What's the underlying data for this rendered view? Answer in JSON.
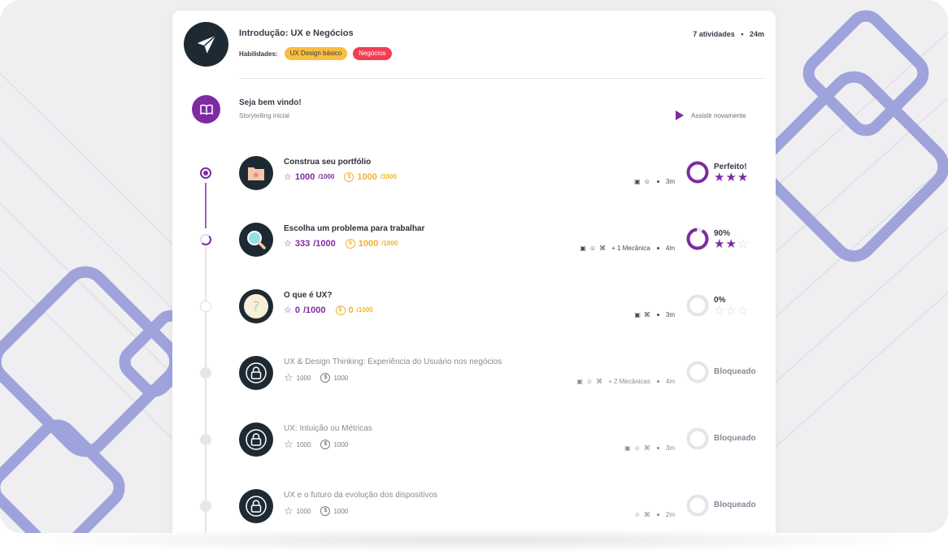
{
  "course": {
    "title": "Introdução: UX e Negócios",
    "activities_count": "7 atividades",
    "duration": "24m",
    "skills_label": "Habilidades:",
    "skills": [
      "UX Design básico",
      "Negócios"
    ]
  },
  "welcome": {
    "title": "Seja bem vindo!",
    "subtitle": "Storytelling inicial",
    "rewatch_label": "Assistir novamente"
  },
  "activities": [
    {
      "title": "Construa seu portfólio",
      "xp": "1000",
      "xp_total": "/1000",
      "coins": "1000",
      "coins_total": "/1000",
      "media_icons": [
        "video-icon",
        "smiley-icon"
      ],
      "mechanics": "",
      "duration": "3m",
      "status": "Perfeito!",
      "progress": 1.0,
      "stars": 3,
      "icon": "folder-star-icon"
    },
    {
      "title": "Escolha um problema para trabalhar",
      "xp": "333",
      "xp_total": "/1000",
      "coins": "1000",
      "coins_total": "/1000",
      "media_icons": [
        "video-icon",
        "smiley-icon",
        "command-icon"
      ],
      "mechanics": "+ 1 Mecânica",
      "duration": "4m",
      "status": "90%",
      "progress": 0.9,
      "stars": 2,
      "icon": "magnifier-icon"
    },
    {
      "title": "O que é UX?",
      "xp": "0",
      "xp_total": "/1000",
      "coins": "0",
      "coins_total": "/1000",
      "media_icons": [
        "video-icon",
        "command-icon"
      ],
      "mechanics": "",
      "duration": "3m",
      "status": "0%",
      "progress": 0.0,
      "stars": 0,
      "icon": "question-icon"
    },
    {
      "title": "UX & Design Thinking: Experiência do Usuário nos negócios",
      "xp": "1000",
      "coins": "1000",
      "media_icons": [
        "video-icon",
        "smiley-icon",
        "command-icon"
      ],
      "mechanics": "+ 2 Mecânicas",
      "duration": "4m",
      "status": "Bloqueado",
      "icon": "lock-icon"
    },
    {
      "title": "UX: Intuição ou Métricas",
      "xp": "1000",
      "coins": "1000",
      "media_icons": [
        "video-icon",
        "smiley-icon",
        "command-icon"
      ],
      "mechanics": "",
      "duration": "3m",
      "status": "Bloqueado",
      "icon": "lock-icon"
    },
    {
      "title": "UX e o futuro da evolução dos dispositivos",
      "xp": "1000",
      "coins": "1000",
      "media_icons": [
        "smiley-icon",
        "command-icon"
      ],
      "mechanics": "",
      "duration": "2m",
      "status": "Bloqueado",
      "icon": "lock-icon"
    }
  ],
  "colors": {
    "primary": "#7d2ba0",
    "coin": "#f2b233",
    "dark_icon_bg": "#1e2a33",
    "tag_yellow": "#f8be3e",
    "tag_red": "#f23d52",
    "background_shapes": "#9fa3dc"
  }
}
